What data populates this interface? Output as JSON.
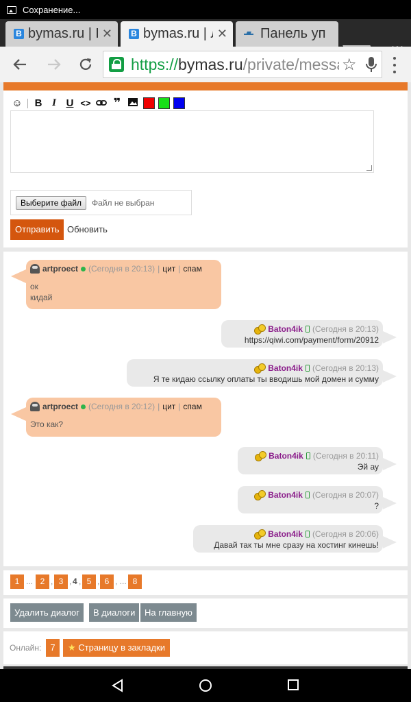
{
  "status": {
    "text": "Сохранение..."
  },
  "tabs": [
    {
      "title": "bymas.ru | Н",
      "favicon": "vk-style-icon"
    },
    {
      "title": "bymas.ru | Л",
      "favicon": "vk-style-icon"
    },
    {
      "title": "Панель уп",
      "favicon": "plane-icon"
    }
  ],
  "url": {
    "scheme": "https://",
    "host": "bymas.ru",
    "path": "/private/messa"
  },
  "editor": {
    "format_buttons": [
      "smile-icon",
      "bold",
      "italic",
      "underline",
      "code",
      "link",
      "quote",
      "image",
      "red",
      "green",
      "blue"
    ],
    "colors": [
      "#f00000",
      "#18e018",
      "#0000f0"
    ],
    "textarea_value": "",
    "file_button": "Выберите файл",
    "file_status": "Файл не выбран",
    "send_label": "Отправить",
    "refresh_label": "Обновить"
  },
  "messages": [
    {
      "dir": "in",
      "author": "artproect",
      "time": "(Сегодня в 20:13)",
      "quote": "цит",
      "spam": "спам",
      "lines": [
        "ок",
        "кидай"
      ]
    },
    {
      "dir": "out",
      "author": "Baton4ik",
      "time": "(Сегодня в 20:13)",
      "lines": [
        "https://qiwi.com/payment/form/20912"
      ]
    },
    {
      "dir": "out",
      "author": "Baton4ik",
      "time": "(Сегодня в 20:13)",
      "lines": [
        "Я те кидаю ссылку оплаты ты вводишь мой домен и сумму"
      ]
    },
    {
      "dir": "in",
      "author": "artproect",
      "time": "(Сегодня в 20:12)",
      "quote": "цит",
      "spam": "спам",
      "lines": [
        "",
        "Это как?"
      ]
    },
    {
      "dir": "out",
      "author": "Baton4ik",
      "time": "(Сегодня в 20:11)",
      "lines": [
        "Эй ау"
      ]
    },
    {
      "dir": "out",
      "author": "Baton4ik",
      "time": "(Сегодня в 20:07)",
      "lines": [
        "?"
      ]
    },
    {
      "dir": "out",
      "author": "Baton4ik",
      "time": "(Сегодня в 20:06)",
      "lines": [
        "Давай так ты мне сразу на хостинг кинешь!"
      ]
    }
  ],
  "pager": {
    "items": [
      "1",
      "...",
      "2",
      ",",
      "3",
      ",",
      "4",
      ",",
      "5",
      ",",
      "6",
      ", ...",
      "8"
    ],
    "current": "4"
  },
  "actions": {
    "delete": "Удалить диалог",
    "dialogs": "В диалоги",
    "home": "На главную"
  },
  "footer": {
    "online_label": "Онлайн:",
    "online_count": "7",
    "bookmark_star": "★",
    "bookmark_label": "Страницу в закладки"
  }
}
